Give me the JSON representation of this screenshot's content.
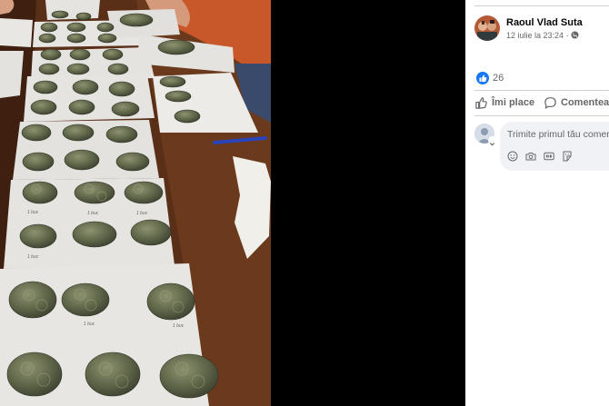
{
  "post": {
    "author": "Raoul Vlad Suta",
    "timestamp": "12 iulie la 23:24",
    "meta_separator": " · ",
    "audience_icon": "globe-icon"
  },
  "reactions": {
    "icon": "like-icon",
    "count": "26"
  },
  "actions": {
    "like_label": "Îmi place",
    "comment_label": "Comentează"
  },
  "comment": {
    "placeholder": "Trimite primul tău comentariu...",
    "tools": [
      "emoji-icon",
      "camera-icon",
      "gif-icon",
      "sticker-icon"
    ]
  },
  "colors": {
    "accent": "#1877f2",
    "secondary_text": "#65676b",
    "divider": "#ced0d4",
    "comment_bg": "#f0f2f5"
  },
  "photo": {
    "labels": [
      "1 buc",
      "1 buc",
      "1 buc",
      "1 buc",
      "1 buc",
      "1 buc"
    ]
  }
}
